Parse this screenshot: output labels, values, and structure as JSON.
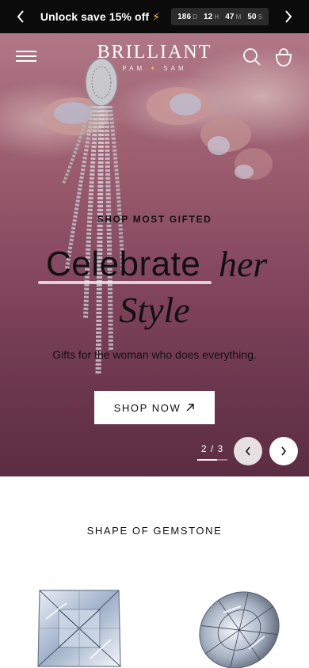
{
  "announcement": {
    "message": "Unlock save 15% off",
    "bolt_icon": "lightning-bolt-icon",
    "countdown": [
      {
        "value": "186",
        "unit": "D"
      },
      {
        "value": "12",
        "unit": "H"
      },
      {
        "value": "47",
        "unit": "M"
      },
      {
        "value": "50",
        "unit": "S"
      }
    ],
    "prev_icon": "chevron-left-icon",
    "next_icon": "chevron-right-icon"
  },
  "header": {
    "logo_name": "BRILLIANT",
    "logo_sub_left": "PAM",
    "logo_sub_right": "SAM",
    "menu_icon": "hamburger-menu-icon",
    "search_icon": "search-icon",
    "bag_icon": "shopping-bag-icon"
  },
  "hero": {
    "eyebrow": "SHOP MOST GIFTED",
    "headline_word_1": "Celebrate",
    "headline_word_2": "her",
    "headline_line_2": "Style",
    "subcopy": "Gifts for the woman who does everything.",
    "cta_label": "SHOP NOW",
    "cta_icon": "arrow-up-right-icon",
    "pager_text": "2 / 3",
    "current_slide": 2,
    "total_slides": 3,
    "prev_icon": "chevron-left-icon",
    "next_icon": "chevron-right-icon"
  },
  "section": {
    "title": "SHAPE OF GEMSTONE",
    "gems": [
      {
        "name": "princess-cut-diamond"
      },
      {
        "name": "oval-cut-diamond"
      }
    ]
  },
  "colors": {
    "announcement_bg": "#0b0b0b",
    "hero_pink": "#a96478",
    "accent_gold": "#e5b96a",
    "bolt": "#ffcc00"
  }
}
